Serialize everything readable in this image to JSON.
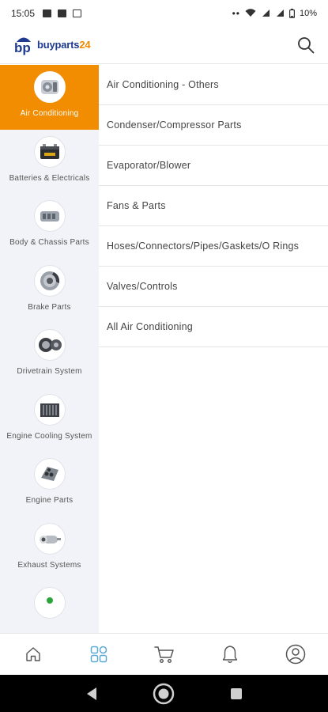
{
  "status_bar": {
    "time": "15:05",
    "battery": "10%"
  },
  "header": {
    "logo_prefix": "bp",
    "logo_name_part1": "buyparts",
    "logo_name_part2": "24",
    "search_icon": "search-icon"
  },
  "colors": {
    "accent": "#f28c00",
    "brand_blue": "#1f3a8f",
    "sidebar_bg": "#f1f3f8",
    "nav_active": "#5aa9d6"
  },
  "categories": [
    {
      "label": "Air Conditioning",
      "icon": "air-conditioning-icon",
      "active": true
    },
    {
      "label": "Batteries & Electricals",
      "icon": "battery-icon",
      "active": false
    },
    {
      "label": "Body & Chassis Parts",
      "icon": "body-chassis-icon",
      "active": false
    },
    {
      "label": "Brake Parts",
      "icon": "brake-disc-icon",
      "active": false
    },
    {
      "label": "Drivetrain System",
      "icon": "drivetrain-icon",
      "active": false
    },
    {
      "label": "Engine Cooling System",
      "icon": "radiator-icon",
      "active": false
    },
    {
      "label": "Engine Parts",
      "icon": "engine-icon",
      "active": false
    },
    {
      "label": "Exhaust Systems",
      "icon": "exhaust-icon",
      "active": false
    }
  ],
  "subcategories": [
    "Air Conditioning - Others",
    "Condenser/Compressor Parts",
    "Evaporator/Blower",
    "Fans & Parts",
    "Hoses/Connectors/Pipes/Gaskets/O Rings",
    "Valves/Controls",
    "All Air Conditioning"
  ],
  "bottom_nav": [
    {
      "icon": "home-icon",
      "active": false
    },
    {
      "icon": "categories-icon",
      "active": true
    },
    {
      "icon": "cart-icon",
      "active": false
    },
    {
      "icon": "bell-icon",
      "active": false
    },
    {
      "icon": "profile-icon",
      "active": false
    }
  ]
}
